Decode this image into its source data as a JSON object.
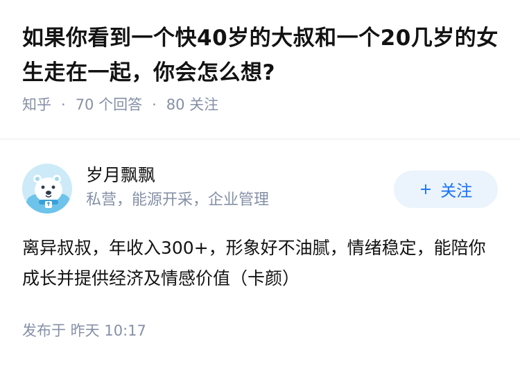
{
  "question": {
    "title": "如果你看到一个快40岁的大叔和一个20几岁的女生走在一起，你会怎么想?",
    "source": "知乎",
    "answers": "70 个回答",
    "followers": "80 关注"
  },
  "answer": {
    "author_name": "岁月飘飘",
    "author_bio": "私营，能源开采，企业管理",
    "follow_label": "关注",
    "follow_plus": "+",
    "content": "离异叔叔，年收入300+，形象好不油腻，情绪稳定，能陪你成长并提供经济及情感价值（卡颜）",
    "published": "发布于  昨天 10:17"
  },
  "colors": {
    "text": "#121212",
    "meta": "#8590a6",
    "accent": "#1772f6",
    "button_bg": "#ebf3fc"
  }
}
